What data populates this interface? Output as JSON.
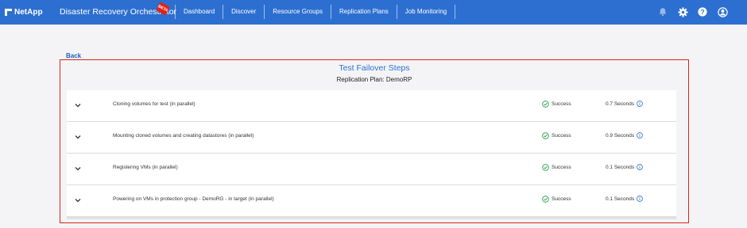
{
  "header": {
    "brand": "NetApp",
    "app_title": "Disaster Recovery Orchestrator",
    "beta_badge": "BETA",
    "nav": [
      "Dashboard",
      "Discover",
      "Resource Groups",
      "Replication Plans",
      "Job Monitoring"
    ],
    "icons": [
      "bell-icon",
      "gear-icon",
      "help-icon",
      "user-icon"
    ]
  },
  "page": {
    "back_label": "Back",
    "title": "Test Failover Steps",
    "plan_label": "Replication Plan: DemoRP"
  },
  "steps": [
    {
      "name": "Cloning volumes for test (in parallel)",
      "status": "Success",
      "duration": "0.7 Seconds"
    },
    {
      "name": "Mounting cloned volumes and creating datastores (in parallel)",
      "status": "Success",
      "duration": "0.9 Seconds"
    },
    {
      "name": "Registering VMs (in parallel)",
      "status": "Success",
      "duration": "0.1 Seconds"
    },
    {
      "name": "Powering on VMs in protection group - DemoRG - in target (in parallel)",
      "status": "Success",
      "duration": "0.1 Seconds"
    }
  ],
  "colors": {
    "header_bg": "#2d6fd0",
    "link": "#1f5fc2",
    "highlight_border": "#e0211a",
    "success": "#2ea44f"
  }
}
